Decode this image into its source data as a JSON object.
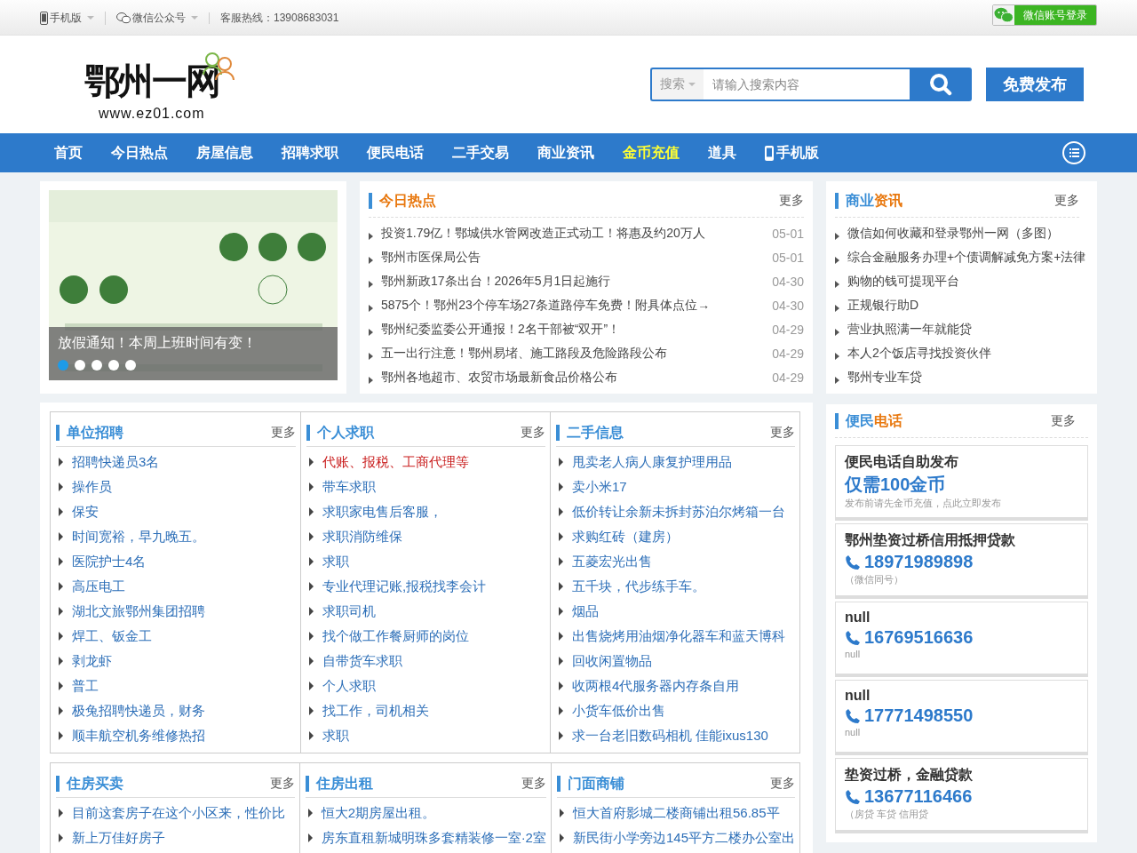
{
  "topbar": {
    "links": [
      {
        "label": "手机版",
        "kind": "phone"
      },
      {
        "label": "微信公众号",
        "kind": "wechat"
      }
    ],
    "hotline": "客服热线：13908683031",
    "login": "微信账号登录"
  },
  "header": {
    "logo_text": "鄂州一网",
    "logo_url": "www.ez01.com",
    "search_scope": "搜索",
    "search_placeholder": "请输入搜索内容",
    "publish": "免费发布"
  },
  "nav": [
    {
      "label": "首页",
      "highlighted": false,
      "kind": "text"
    },
    {
      "label": "今日热点",
      "highlighted": false,
      "kind": "text"
    },
    {
      "label": "房屋信息",
      "highlighted": false,
      "kind": "text"
    },
    {
      "label": "招聘求职",
      "highlighted": false,
      "kind": "text"
    },
    {
      "label": "便民电话",
      "highlighted": false,
      "kind": "text"
    },
    {
      "label": "二手交易",
      "highlighted": false,
      "kind": "text"
    },
    {
      "label": "商业资讯",
      "highlighted": false,
      "kind": "text"
    },
    {
      "label": "金币充值",
      "highlighted": true,
      "kind": "text"
    },
    {
      "label": "道具",
      "highlighted": false,
      "kind": "text"
    },
    {
      "label": "手机版",
      "highlighted": false,
      "kind": "phone"
    }
  ],
  "slider": {
    "caption": "放假通知！本周上班时间有变！",
    "dots": [
      {
        "selected": true
      },
      {
        "selected": false
      },
      {
        "selected": false
      },
      {
        "selected": false
      },
      {
        "selected": false
      }
    ]
  },
  "hot": {
    "title_parts": [
      {
        "text": "今日热点",
        "accent": true
      }
    ],
    "more": "更多",
    "items": [
      {
        "text": "投资1.79亿！鄂城供水管网改造正式动工！将惠及约20万人",
        "date": "05-01"
      },
      {
        "text": "鄂州市医保局公告",
        "date": "05-01"
      },
      {
        "text": "鄂州新政17条出台！2026年5月1日起施行",
        "date": "04-30"
      },
      {
        "text": "5875个！鄂州23个停车场27条道路停车免费！附具体点位→",
        "date": "04-30"
      },
      {
        "text": "鄂州纪委监委公开通报！2名干部被“双开”！",
        "date": "04-29"
      },
      {
        "text": "五一出行注意！鄂州易堵、施工路段及危险路段公布",
        "date": "04-29"
      },
      {
        "text": "鄂州各地超市、农贸市场最新食品价格公布",
        "date": "04-29"
      }
    ]
  },
  "business": {
    "title_parts": [
      {
        "text": "商业",
        "accent": false
      },
      {
        "text": "资讯",
        "accent": true
      }
    ],
    "more": "更多",
    "items": [
      "微信如何收藏和登录鄂州一网（多图）",
      "综合金融服务办理+个债调解减免方案+法律",
      "购物的钱可提现平台",
      "正规银行助D",
      "营业执照满一年就能贷",
      "本人2个饭店寻找投资伙伴",
      "鄂州专业车贷"
    ]
  },
  "grid_rows": [
    [
      {
        "title": "单位招聘",
        "more": "更多",
        "items": [
          {
            "text": "招聘快递员3名",
            "highlighted": false
          },
          {
            "text": "操作员",
            "highlighted": false
          },
          {
            "text": "保安",
            "highlighted": false
          },
          {
            "text": "时间宽裕，早九晚五。",
            "highlighted": false
          },
          {
            "text": "医院护士4名",
            "highlighted": false
          },
          {
            "text": "高压电工",
            "highlighted": false
          },
          {
            "text": "湖北文旅鄂州集团招聘",
            "highlighted": false
          },
          {
            "text": "焊工、钣金工",
            "highlighted": false
          },
          {
            "text": "剥龙虾",
            "highlighted": false
          },
          {
            "text": "普工",
            "highlighted": false
          },
          {
            "text": "极兔招聘快递员，财务",
            "highlighted": false
          },
          {
            "text": "顺丰航空机务维修热招",
            "highlighted": false
          }
        ]
      },
      {
        "title": "个人求职",
        "more": "更多",
        "items": [
          {
            "text": "代账、报税、工商代理等",
            "highlighted": true
          },
          {
            "text": "带车求职",
            "highlighted": false
          },
          {
            "text": "求职家电售后客服，",
            "highlighted": false
          },
          {
            "text": "求职消防维保",
            "highlighted": false
          },
          {
            "text": "求职",
            "highlighted": false
          },
          {
            "text": "专业代理记账,报税找李会计",
            "highlighted": false
          },
          {
            "text": "求职司机",
            "highlighted": false
          },
          {
            "text": "找个做工作餐厨师的岗位",
            "highlighted": false
          },
          {
            "text": "自带货车求职",
            "highlighted": false
          },
          {
            "text": "个人求职",
            "highlighted": false
          },
          {
            "text": "找工作，司机相关",
            "highlighted": false
          },
          {
            "text": "求职",
            "highlighted": false
          }
        ]
      },
      {
        "title": "二手信息",
        "more": "更多",
        "items": [
          {
            "text": "甩卖老人病人康复护理用品",
            "highlighted": false
          },
          {
            "text": "卖小米17",
            "highlighted": false
          },
          {
            "text": "低价转让余新未拆封苏泊尔烤箱一台",
            "highlighted": false
          },
          {
            "text": "求购红砖（建房）",
            "highlighted": false
          },
          {
            "text": "五菱宏光出售",
            "highlighted": false
          },
          {
            "text": "五千块，代步练手车。",
            "highlighted": false
          },
          {
            "text": "烟品",
            "highlighted": false
          },
          {
            "text": "出售烧烤用油烟净化器车和蓝天博科",
            "highlighted": false
          },
          {
            "text": "回收闲置物品",
            "highlighted": false
          },
          {
            "text": "收两根4代服务器内存条自用",
            "highlighted": false
          },
          {
            "text": "小货车低价出售",
            "highlighted": false
          },
          {
            "text": "求一台老旧数码相机 佳能ixus130",
            "highlighted": false
          }
        ]
      }
    ],
    [
      {
        "title": "住房买卖",
        "more": "更多",
        "items": [
          {
            "text": "目前这套房子在这个小区来，性价比",
            "highlighted": false
          },
          {
            "text": "新上万佳好房子",
            "highlighted": false
          }
        ]
      },
      {
        "title": "住房出租",
        "more": "更多",
        "items": [
          {
            "text": "恒大2期房屋出租。",
            "highlighted": false
          },
          {
            "text": "房东直租新城明珠多套精装修一室·2室",
            "highlighted": false
          }
        ]
      },
      {
        "title": "门面商铺",
        "more": "更多",
        "items": [
          {
            "text": "恒大首府影城二楼商铺出租56.85平",
            "highlighted": false
          },
          {
            "text": "新民街小学旁边145平方二楼办公室出",
            "highlighted": false
          }
        ]
      }
    ]
  ],
  "phones": {
    "title_parts": [
      {
        "text": "便民",
        "accent": false
      },
      {
        "text": "电话",
        "accent": true
      }
    ],
    "more": "更多",
    "cards": [
      {
        "kind": "promo",
        "title": "便民电话自助发布",
        "price": "仅需100金币",
        "note": "发布前请先金币充值，点此立即发布"
      },
      {
        "kind": "phone",
        "title": "鄂州垫资过桥信用抵押贷款",
        "phone": "18971989898",
        "note": "（微信同号）"
      },
      {
        "kind": "phone",
        "title": "null",
        "phone": "16769516636",
        "note": "null"
      },
      {
        "kind": "phone",
        "title": "null",
        "phone": "17771498550",
        "note": "null"
      },
      {
        "kind": "phone",
        "title": "垫资过桥，金融贷款",
        "phone": "13677116466",
        "note": "（房贷 车贷 信用贷"
      }
    ]
  }
}
